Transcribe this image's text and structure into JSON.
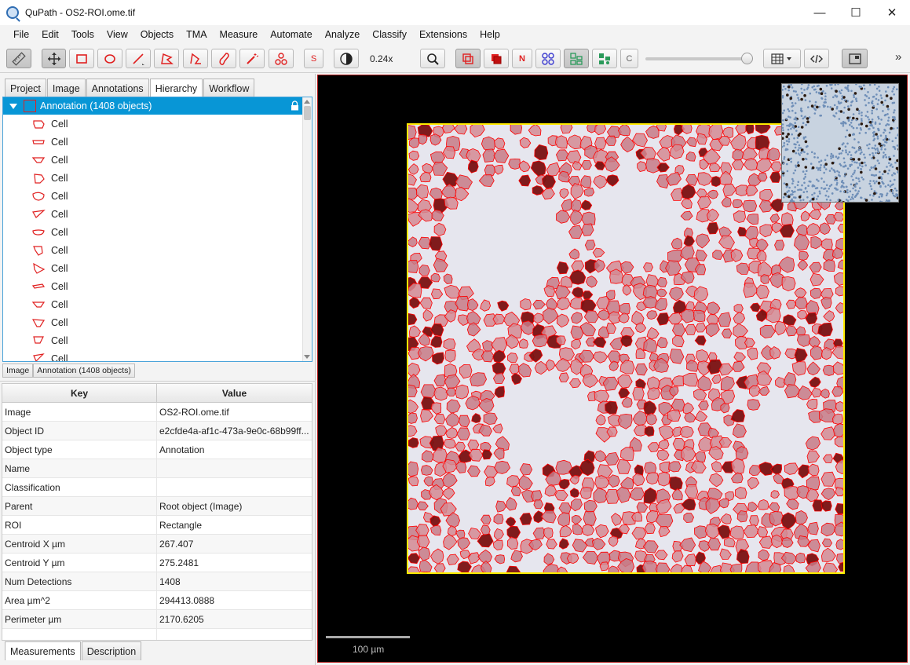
{
  "window": {
    "title": "QuPath - OS2-ROI.ome.tif",
    "minimize": "—",
    "maximize": "☐",
    "close": "✕"
  },
  "menu": [
    "File",
    "Edit",
    "Tools",
    "View",
    "Objects",
    "TMA",
    "Measure",
    "Automate",
    "Analyze",
    "Classify",
    "Extensions",
    "Help"
  ],
  "toolbar": {
    "zoom": "0.24x",
    "s_label": "S",
    "n_label": "N",
    "c_label": "C",
    "more": "»",
    "opacity_slider_level": 1.0
  },
  "left_tabs": [
    "Project",
    "Image",
    "Annotations",
    "Hierarchy",
    "Workflow"
  ],
  "active_left_tab": "Hierarchy",
  "hierarchy": {
    "root_label": "Annotation (1408 objects)",
    "items": [
      "Cell",
      "Cell",
      "Cell",
      "Cell",
      "Cell",
      "Cell",
      "Cell",
      "Cell",
      "Cell",
      "Cell",
      "Cell",
      "Cell",
      "Cell",
      "Cell"
    ]
  },
  "breadcrumb": [
    "Image",
    "Annotation (1408 objects)"
  ],
  "properties": {
    "key_header": "Key",
    "value_header": "Value",
    "rows": [
      {
        "key": "Image",
        "value": "OS2-ROI.ome.tif"
      },
      {
        "key": "Object ID",
        "value": "e2cfde4a-af1c-473a-9e0c-68b99ff..."
      },
      {
        "key": "Object type",
        "value": "Annotation"
      },
      {
        "key": "Name",
        "value": ""
      },
      {
        "key": "Classification",
        "value": ""
      },
      {
        "key": "Parent",
        "value": "Root object (Image)"
      },
      {
        "key": "ROI",
        "value": "Rectangle"
      },
      {
        "key": "Centroid X µm",
        "value": "267.407"
      },
      {
        "key": "Centroid Y µm",
        "value": "275.2481"
      },
      {
        "key": "Num Detections",
        "value": "1408"
      },
      {
        "key": "Area µm^2",
        "value": "294413.0888"
      },
      {
        "key": "Perimeter µm",
        "value": "2170.6205"
      }
    ]
  },
  "bottom_tabs": [
    "Measurements",
    "Description"
  ],
  "viewer": {
    "scale_label": "100 µm"
  },
  "colors": {
    "selection": "#0896d6",
    "annotation_border": "#ffeb00",
    "cell_outline": "#ff0000",
    "viewer_border": "#b01818"
  }
}
